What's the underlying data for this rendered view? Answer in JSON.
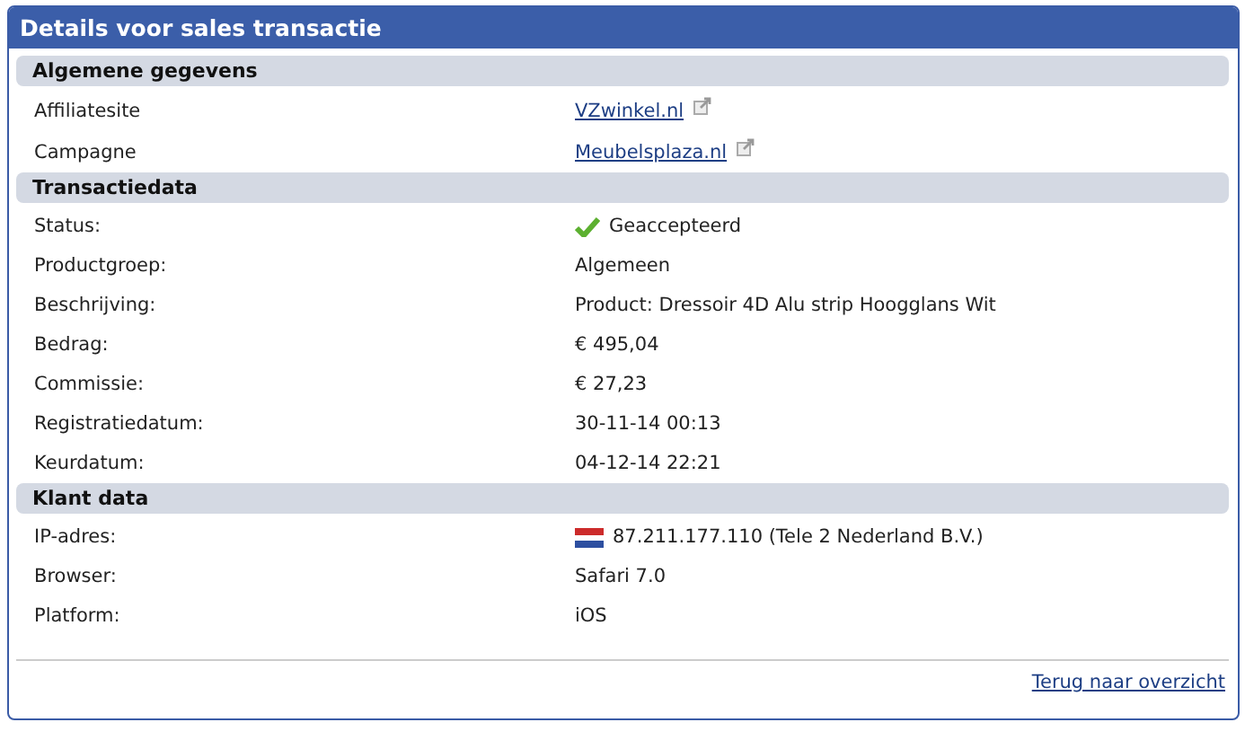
{
  "window": {
    "title": "Details voor sales transactie"
  },
  "sections": [
    {
      "title": "Algemene gegevens",
      "rows": [
        {
          "label": "Affiliatesite",
          "value": "VZwinkel.nl",
          "kind": "link"
        },
        {
          "label": "Campagne",
          "value": "Meubelsplaza.nl",
          "kind": "link"
        }
      ]
    },
    {
      "title": "Transactiedata",
      "rows": [
        {
          "label": "Status:",
          "value": "Geaccepteerd",
          "kind": "status"
        },
        {
          "label": "Productgroep:",
          "value": "Algemeen",
          "kind": "text"
        },
        {
          "label": "Beschrijving:",
          "value": "Product: Dressoir 4D Alu strip Hoogglans Wit",
          "kind": "text"
        },
        {
          "label": "Bedrag:",
          "value": "€ 495,04",
          "kind": "text"
        },
        {
          "label": "Commissie:",
          "value": "€ 27,23",
          "kind": "text"
        },
        {
          "label": "Registratiedatum:",
          "value": "30-11-14 00:13",
          "kind": "text"
        },
        {
          "label": "Keurdatum:",
          "value": "04-12-14 22:21",
          "kind": "text"
        }
      ]
    },
    {
      "title": "Klant data",
      "rows": [
        {
          "label": "IP-adres:",
          "value": "87.211.177.110 (Tele 2 Nederland B.V.)",
          "kind": "flag"
        },
        {
          "label": "Browser:",
          "value": "Safari 7.0",
          "kind": "text"
        },
        {
          "label": "Platform:",
          "value": "iOS",
          "kind": "text"
        }
      ]
    }
  ],
  "footer": {
    "link": "Terug naar overzicht"
  }
}
